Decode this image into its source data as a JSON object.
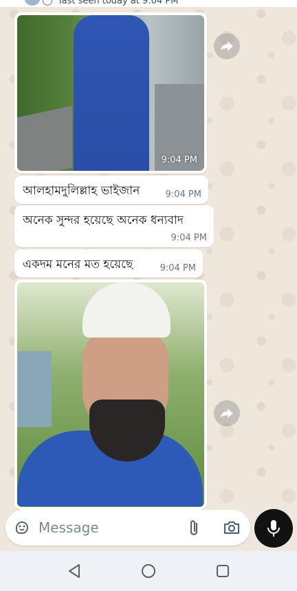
{
  "header": {
    "status": "last seen today at 9:04 PM"
  },
  "messages": [
    {
      "type": "image",
      "time": "9:04 PM"
    },
    {
      "type": "text",
      "text": "আলহামদুলিল্লাহ ভাইজান",
      "time": "9:04 PM"
    },
    {
      "type": "text",
      "text": "অনেক সুন্দর হয়েছে অনেক ধন্যবাদ",
      "time": "9:04 PM"
    },
    {
      "type": "text",
      "text": "একদম মনের মত হয়েছে",
      "time": "9:04 PM"
    },
    {
      "type": "image"
    }
  ],
  "composer": {
    "placeholder": "Message"
  },
  "icons": [
    "sticker-icon",
    "attach-icon",
    "camera-icon",
    "mic-icon",
    "forward-icon",
    "nav-back-icon",
    "nav-home-icon",
    "nav-recents-icon"
  ],
  "colors": {
    "chat_background": "#efe7dd",
    "bubble": "#ffffff",
    "mic_button": "#121212",
    "navbar": "#eef1f6"
  }
}
